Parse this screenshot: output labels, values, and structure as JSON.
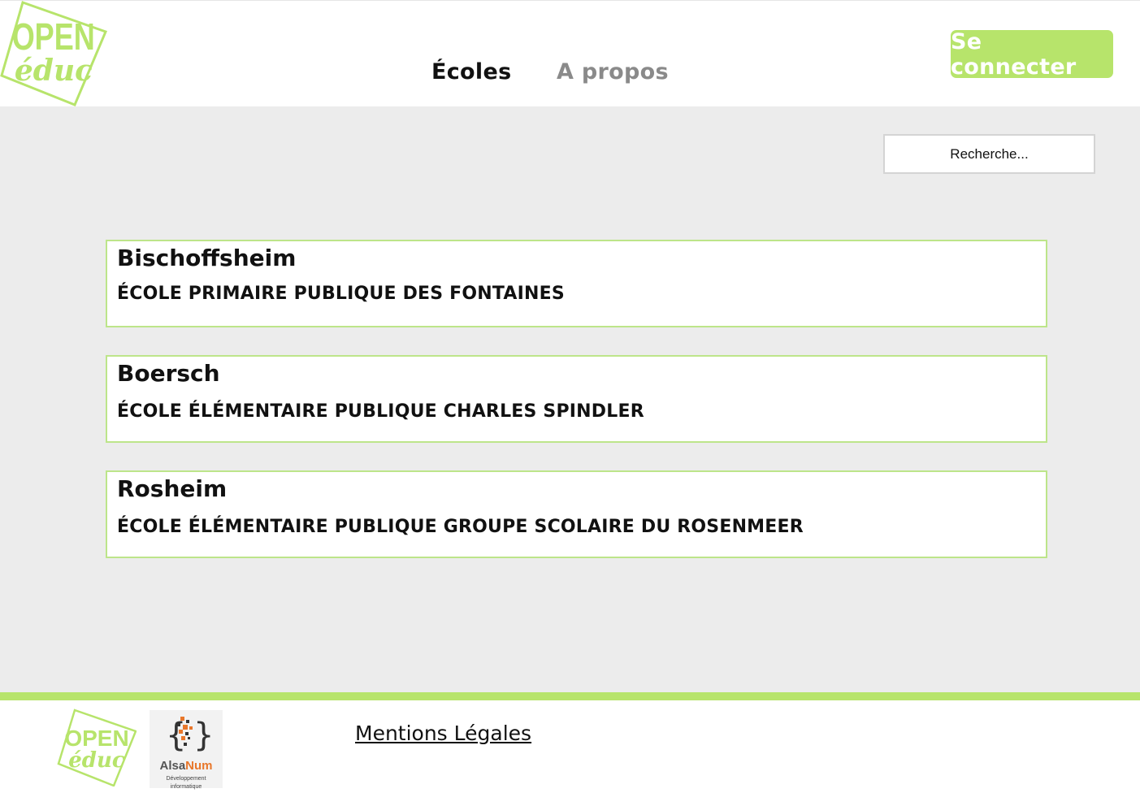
{
  "header": {
    "logo": {
      "line1": "OPEN",
      "line2": "éduc",
      "color": "#b7e46b"
    },
    "nav": [
      {
        "label": "Écoles",
        "active": true
      },
      {
        "label": "A propos",
        "active": false
      }
    ],
    "login_label": "Se connecter",
    "accent_color": "#b7e46b"
  },
  "search": {
    "placeholder": "Recherche..."
  },
  "schools": [
    {
      "city": "Bischoffsheim",
      "name": "ÉCOLE PRIMAIRE PUBLIQUE DES FONTAINES"
    },
    {
      "city": "Boersch",
      "name": "ÉCOLE ÉLÉMENTAIRE PUBLIQUE CHARLES SPINDLER"
    },
    {
      "city": "Rosheim",
      "name": "ÉCOLE ÉLÉMENTAIRE PUBLIQUE GROUPE SCOLAIRE DU ROSENMEER"
    }
  ],
  "footer": {
    "logo": {
      "line1": "OPEN",
      "line2": "éduc"
    },
    "partner": {
      "name_part1": "Alsa",
      "name_part2": "Num",
      "subtitle_line1": "Développement",
      "subtitle_line2": "informatique"
    },
    "mentions_label": "Mentions Légales"
  }
}
